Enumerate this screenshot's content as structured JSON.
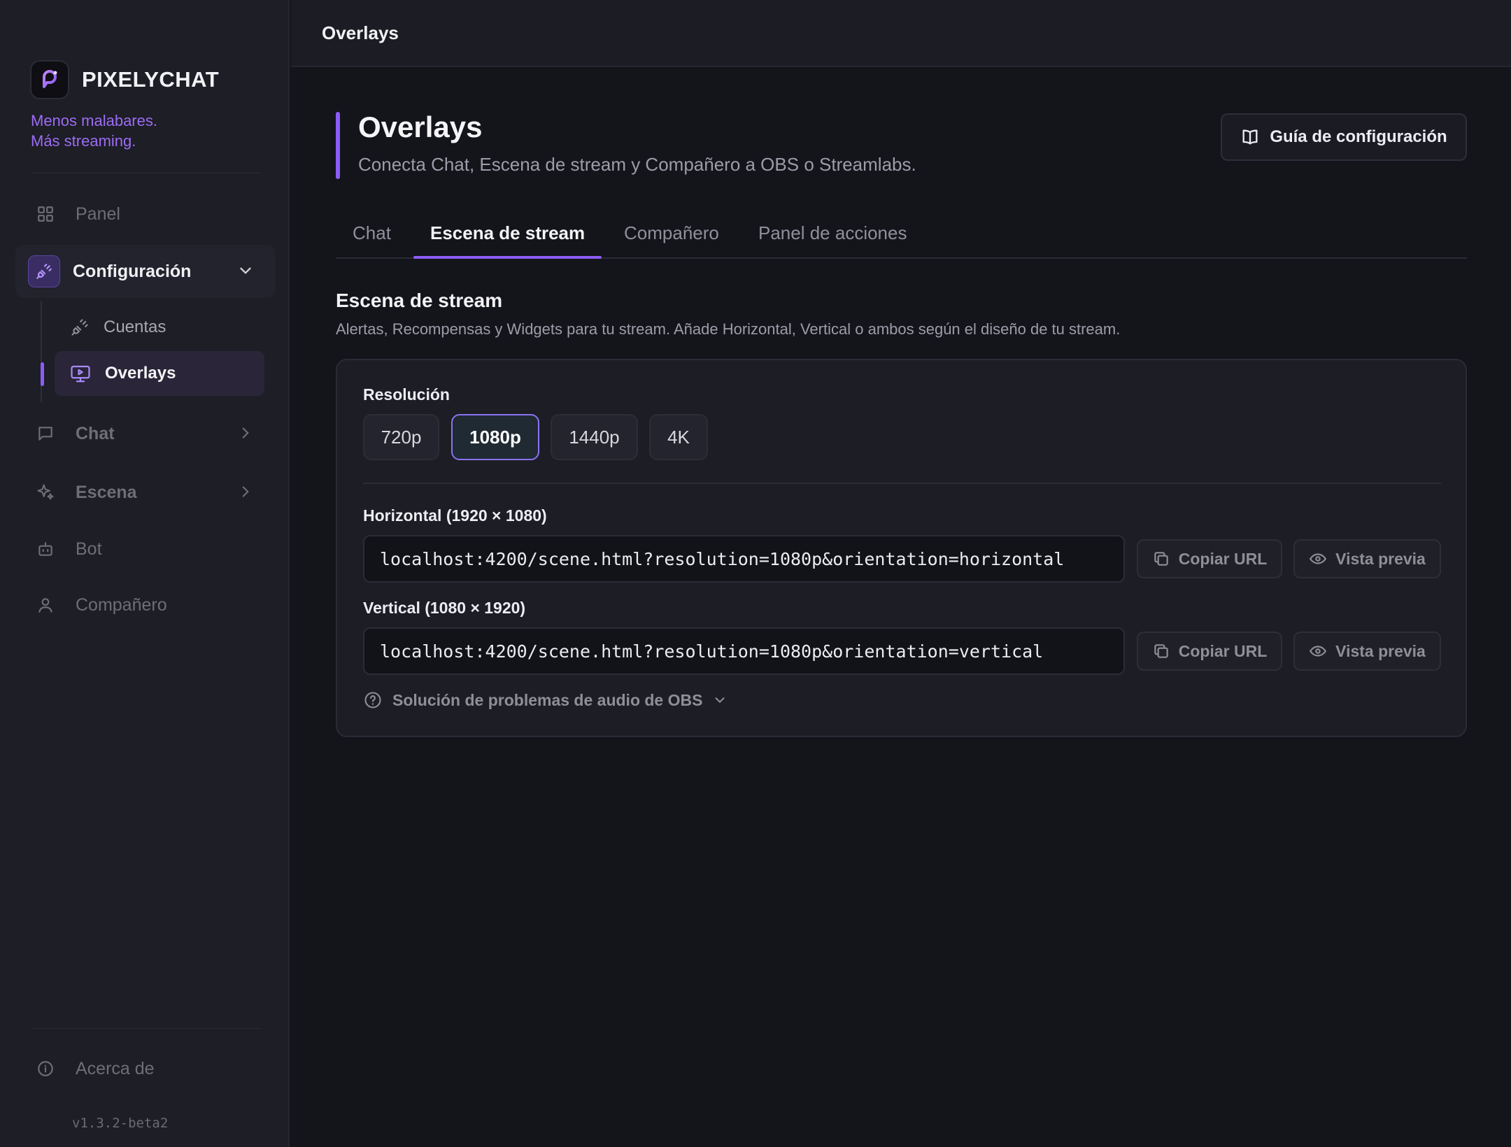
{
  "app": {
    "name": "PIXELYCHAT",
    "tagline_line1": "Menos malabares.",
    "tagline_line2": "Más streaming.",
    "version": "v1.3.2-beta2",
    "colors": {
      "accent": "#8b5cf6",
      "background": "#14151b",
      "sidebar": "#1d1e26"
    }
  },
  "sidebar": {
    "items": [
      {
        "label": "Panel",
        "icon": "grid-icon"
      },
      {
        "label": "Configuración",
        "icon": "plug-icon",
        "expanded": true
      },
      {
        "label": "Chat",
        "icon": "chat-bubble-icon"
      },
      {
        "label": "Escena",
        "icon": "sparkles-icon"
      },
      {
        "label": "Bot",
        "icon": "robot-icon"
      },
      {
        "label": "Compañero",
        "icon": "user-icon"
      }
    ],
    "sub_items": [
      {
        "label": "Cuentas",
        "icon": "plug-icon"
      },
      {
        "label": "Overlays",
        "icon": "monitor-play-icon",
        "active": true
      }
    ],
    "footer": {
      "label": "Acerca de",
      "icon": "info-icon"
    }
  },
  "topbar": {
    "title": "Overlays"
  },
  "page": {
    "title": "Overlays",
    "subtitle": "Conecta Chat, Escena de stream y Compañero a OBS o Streamlabs.",
    "guide_button": "Guía de configuración"
  },
  "tabs": [
    {
      "label": "Chat"
    },
    {
      "label": "Escena de stream",
      "active": true
    },
    {
      "label": "Compañero"
    },
    {
      "label": "Panel de acciones"
    }
  ],
  "section": {
    "title": "Escena de stream",
    "description": "Alertas, Recompensas y Widgets para tu stream. Añade Horizontal, Vertical o ambos según el diseño de tu stream."
  },
  "resolution": {
    "label": "Resolución",
    "options": [
      "720p",
      "1080p",
      "1440p",
      "4K"
    ],
    "selected": "1080p"
  },
  "urls": [
    {
      "label": "Horizontal (1920 × 1080)",
      "value": "localhost:4200/scene.html?resolution=1080p&orientation=horizontal",
      "copy_label": "Copiar URL",
      "preview_label": "Vista previa"
    },
    {
      "label": "Vertical (1080 × 1920)",
      "value": "localhost:4200/scene.html?resolution=1080p&orientation=vertical",
      "copy_label": "Copiar URL",
      "preview_label": "Vista previa"
    }
  ],
  "troubleshoot": {
    "label": "Solución de problemas de audio de OBS"
  }
}
